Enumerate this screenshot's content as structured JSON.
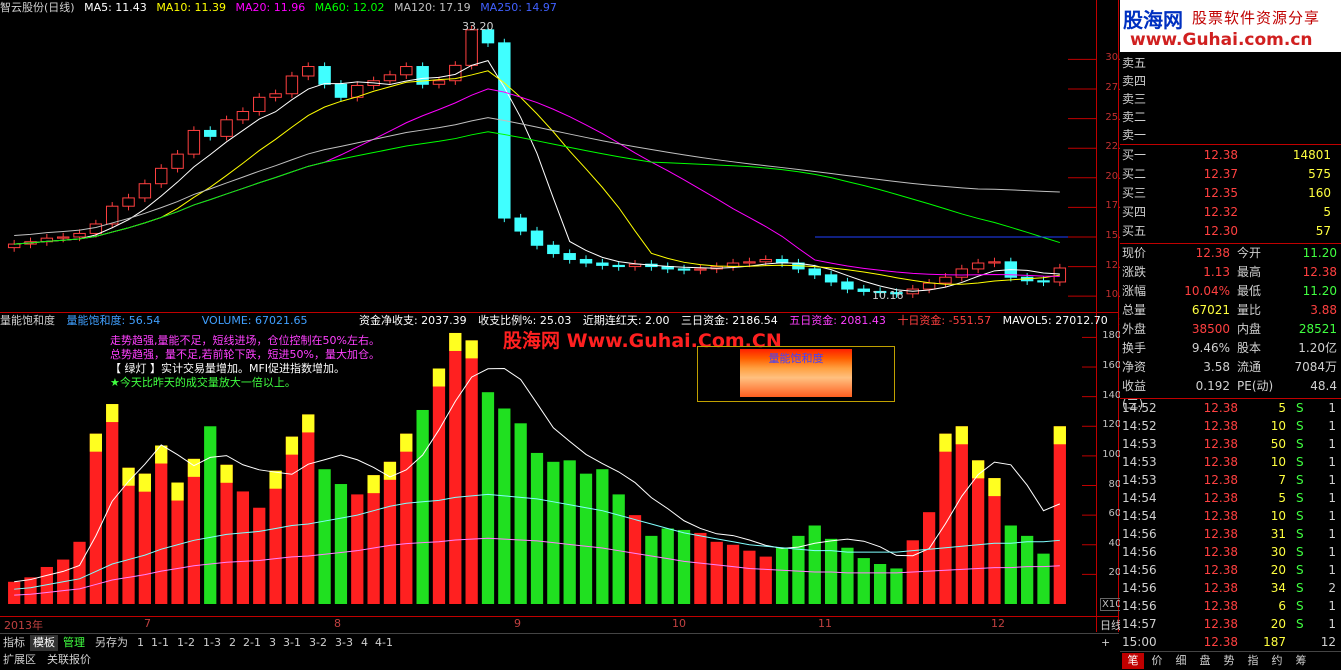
{
  "ma_legend": {
    "title": "智云股份(日线)",
    "ma5": "MA5: 11.43",
    "ma10": "MA10: 11.39",
    "ma20": "MA20: 11.96",
    "ma60": "MA60: 12.02",
    "ma120": "MA120: 17.19",
    "ma250": "MA250: 14.97",
    "colors": {
      "ma5": "#ffffff",
      "ma10": "#ffff00",
      "ma20": "#ff00ff",
      "ma60": "#00ff00",
      "ma120": "#c0c0c0",
      "ma250": "#4040ff"
    }
  },
  "price_axis": [
    "30.00",
    "27.50",
    "25.00",
    "22.50",
    "20.00",
    "17.50",
    "15.00",
    "12.50",
    "10.00"
  ],
  "price_high_label": "33.20",
  "price_low_label": "10.16",
  "volume_legend": {
    "indicator": "量能饱和度",
    "indicator2": "量能饱和度: 56.54",
    "volume": "VOLUME: 67021.65",
    "fund_net": "资金净收支: 2037.39",
    "ratio": "收支比例%: 25.03",
    "streak": "近期连红天: 2.00",
    "day3": "三日资金: 2186.54",
    "day5": "五日资金: 2081.43",
    "day10": "十日资金: -551.57",
    "mavol5": "MAVOL5: 27012.70",
    "tail": "资"
  },
  "volume_axis": [
    "18000",
    "16000",
    "14000",
    "12000",
    "10000",
    "8000",
    "6000",
    "4000",
    "2000"
  ],
  "volume_unit": "X10",
  "legend_lines": [
    "走势趋强,量能不足，短线进场，仓位控制在50%左右。",
    "总势趋强，量不足,若前轮下跌，短进50%，量大加仓。",
    "【 绿灯 】实计交易量增加。MFI促进指数增加。",
    "★今天比昨天的成交量放大一倍以上。"
  ],
  "legend_box_title": "量能饱和度",
  "watermark": "股海网 Www.Guhai.Com.CN",
  "months": [
    "2013年",
    "7",
    "8",
    "9",
    "10",
    "11",
    "12"
  ],
  "period": "日线",
  "bottom_tabs": [
    "指标",
    "模板",
    "管理",
    "另存为",
    "1",
    "1-1",
    "1-2",
    "1-3",
    "2",
    "2-1",
    "3",
    "3-1",
    "3-2",
    "3-3",
    "4",
    "4-1"
  ],
  "bottom_tabs2": [
    "扩展区",
    "关联报价"
  ],
  "logo": {
    "brand": "股海网",
    "slogan": "股票软件资源分享",
    "url": "www.Guhai.com.cn"
  },
  "sell_labels": [
    "卖五",
    "卖四",
    "卖三",
    "卖二",
    "卖一"
  ],
  "buy_rows": [
    {
      "label": "买一",
      "price": "12.38",
      "vol": "14801"
    },
    {
      "label": "买二",
      "price": "12.37",
      "vol": "575"
    },
    {
      "label": "买三",
      "price": "12.35",
      "vol": "160"
    },
    {
      "label": "买四",
      "price": "12.32",
      "vol": "5"
    },
    {
      "label": "买五",
      "price": "12.30",
      "vol": "57"
    }
  ],
  "info_rows": [
    {
      "k": "现价",
      "v1": "12.38",
      "c1": "#ff4040",
      "k2": "今开",
      "v2": "11.20",
      "c2": "#40ff40"
    },
    {
      "k": "涨跌",
      "v1": "1.13",
      "c1": "#ff4040",
      "k2": "最高",
      "v2": "12.38",
      "c2": "#ff4040"
    },
    {
      "k": "涨幅",
      "v1": "10.04%",
      "c1": "#ff4040",
      "k2": "最低",
      "v2": "11.20",
      "c2": "#40ff40"
    },
    {
      "k": "总量",
      "v1": "67021",
      "c1": "#ffff40",
      "k2": "量比",
      "v2": "3.88",
      "c2": "#ff4040"
    },
    {
      "k": "外盘",
      "v1": "38500",
      "c1": "#ff4040",
      "k2": "内盘",
      "v2": "28521",
      "c2": "#40ff40"
    },
    {
      "k": "换手",
      "v1": "9.46%",
      "c1": "#d0d0d0",
      "k2": "股本",
      "v2": "1.20亿",
      "c2": "#d0d0d0"
    },
    {
      "k": "净资",
      "v1": "3.58",
      "c1": "#d0d0d0",
      "k2": "流通",
      "v2": "7084万",
      "c2": "#d0d0d0"
    },
    {
      "k": "收益(三)",
      "v1": "0.192",
      "c1": "#d0d0d0",
      "k2": "PE(动)",
      "v2": "48.4",
      "c2": "#d0d0d0"
    }
  ],
  "ticks": [
    {
      "t": "14:52",
      "p": "12.38",
      "v": "5",
      "s": "S",
      "n": "1"
    },
    {
      "t": "14:52",
      "p": "12.38",
      "v": "10",
      "s": "S",
      "n": "1"
    },
    {
      "t": "14:53",
      "p": "12.38",
      "v": "50",
      "s": "S",
      "n": "1"
    },
    {
      "t": "14:53",
      "p": "12.38",
      "v": "10",
      "s": "S",
      "n": "1"
    },
    {
      "t": "14:53",
      "p": "12.38",
      "v": "7",
      "s": "S",
      "n": "1"
    },
    {
      "t": "14:54",
      "p": "12.38",
      "v": "5",
      "s": "S",
      "n": "1"
    },
    {
      "t": "14:54",
      "p": "12.38",
      "v": "10",
      "s": "S",
      "n": "1"
    },
    {
      "t": "14:56",
      "p": "12.38",
      "v": "31",
      "s": "S",
      "n": "1"
    },
    {
      "t": "14:56",
      "p": "12.38",
      "v": "30",
      "s": "S",
      "n": "1"
    },
    {
      "t": "14:56",
      "p": "12.38",
      "v": "20",
      "s": "S",
      "n": "1"
    },
    {
      "t": "14:56",
      "p": "12.38",
      "v": "34",
      "s": "S",
      "n": "2"
    },
    {
      "t": "14:56",
      "p": "12.38",
      "v": "6",
      "s": "S",
      "n": "1"
    },
    {
      "t": "14:57",
      "p": "12.38",
      "v": "20",
      "s": "S",
      "n": "1"
    },
    {
      "t": "15:00",
      "p": "12.38",
      "v": "187",
      "s": "",
      "n": "12"
    }
  ],
  "right_tabs": [
    "笔",
    "价",
    "细",
    "盘",
    "势",
    "指",
    "约",
    "筹"
  ],
  "chart_data": {
    "type": "candlestick+bar",
    "ylim_price": [
      9,
      33.5
    ],
    "ylim_volume": [
      0,
      18500
    ],
    "price_close": [
      14.4,
      14.6,
      14.9,
      15.0,
      15.3,
      16.1,
      17.6,
      18.3,
      19.5,
      20.8,
      22.0,
      24.0,
      23.5,
      24.9,
      25.6,
      26.8,
      27.1,
      28.6,
      29.4,
      27.9,
      26.8,
      27.8,
      28.2,
      28.7,
      29.4,
      27.9,
      28.2,
      29.5,
      32.5,
      31.4,
      16.6,
      15.5,
      14.3,
      13.6,
      13.1,
      12.8,
      12.6,
      12.5,
      12.7,
      12.5,
      12.3,
      12.2,
      12.3,
      12.5,
      12.8,
      12.9,
      13.1,
      12.8,
      12.3,
      11.8,
      11.2,
      10.6,
      10.4,
      10.3,
      10.2,
      10.6,
      11.1,
      11.6,
      12.3,
      12.8,
      12.9,
      11.6,
      11.3,
      11.2,
      12.38
    ],
    "volume": [
      1500,
      1800,
      2500,
      3000,
      4200,
      11500,
      13500,
      9200,
      8800,
      10700,
      8200,
      9800,
      12000,
      9400,
      7600,
      6500,
      9000,
      11300,
      12800,
      9100,
      8100,
      7400,
      8700,
      9600,
      11500,
      13100,
      15900,
      18300,
      17800,
      14300,
      13200,
      12200,
      10200,
      9600,
      9700,
      8800,
      9100,
      7400,
      6000,
      4600,
      5100,
      5000,
      4800,
      4200,
      4000,
      3600,
      3200,
      3800,
      4600,
      5300,
      4400,
      3800,
      3100,
      2700,
      2400,
      4300,
      6200,
      11500,
      12000,
      9700,
      8500,
      5300,
      4600,
      3400,
      12000
    ],
    "mavol5_trend": [
      1000,
      1100,
      1300,
      1500,
      1700,
      2200,
      2700,
      3000,
      3300,
      3700,
      4000,
      4300,
      4500,
      4700,
      4800,
      4900,
      5100,
      5300,
      5400,
      5600,
      5800,
      6000,
      6300,
      6600,
      6800,
      6900,
      7000,
      7200,
      7300,
      7400,
      7300,
      7200,
      7100,
      6900,
      6700,
      6500,
      6300,
      6000,
      5700,
      5400,
      5100,
      4800,
      4600,
      4400,
      4200,
      4000,
      3900,
      3800,
      3700,
      3600,
      3600,
      3500,
      3500,
      3500,
      3500,
      3600,
      3700,
      3800,
      3900,
      4000,
      4100,
      4100,
      4200,
      4200,
      4300
    ]
  }
}
